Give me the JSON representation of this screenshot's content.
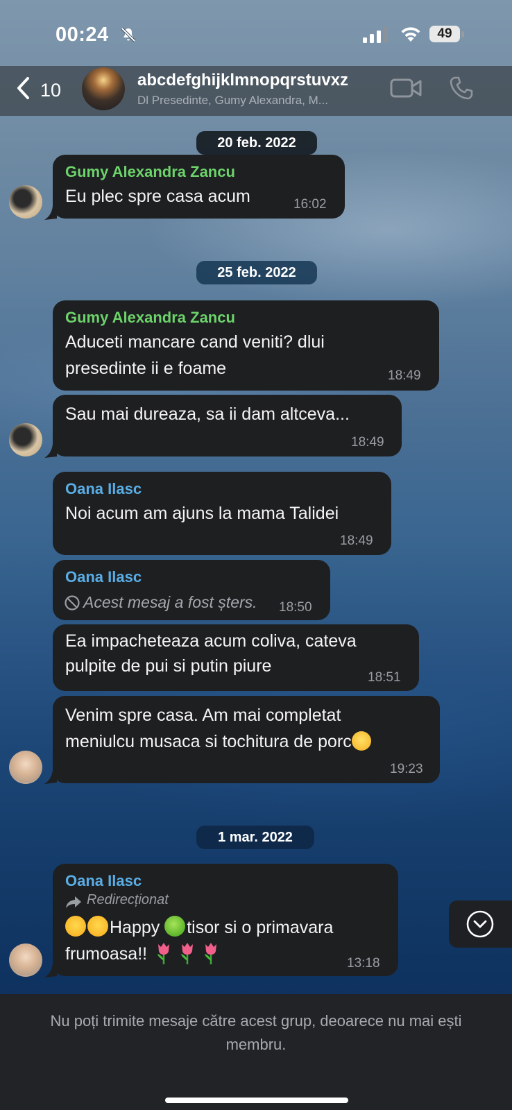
{
  "status_bar": {
    "time": "00:24",
    "battery": "49"
  },
  "header": {
    "back_count": "10",
    "title": "abcdefghijklmnopqrstuvxz",
    "subtitle": "Dl Presedinte, Gumy Alexandra, M..."
  },
  "dates": [
    "20 feb. 2022",
    "25 feb. 2022",
    "1 mar. 2022"
  ],
  "messages": [
    {
      "sender": "Gumy Alexandra Zancu",
      "text": "Eu plec spre casa acum",
      "time": "16:02"
    },
    {
      "sender": "Gumy Alexandra Zancu",
      "lines": [
        "Aduceti mancare cand veniti? dlui",
        "presedinte ii e foame"
      ],
      "time": "18:49"
    },
    {
      "text": "Sau mai dureaza, sa ii dam altceva...",
      "time": "18:49"
    },
    {
      "sender": "Oana Ilasc",
      "text": "Noi acum am ajuns la mama Talidei",
      "time": "18:49"
    },
    {
      "sender": "Oana Ilasc",
      "text": "Acest mesaj a fost șters.",
      "time": "18:50"
    },
    {
      "lines": [
        "Ea impacheteaza acum coliva, cateva",
        "pulpite de pui si putin piure"
      ],
      "time": "18:51"
    },
    {
      "lines": [
        "Venim spre casa. Am mai completat",
        "meniulcu musaca si tochitura de porc"
      ],
      "time": "19:23"
    },
    {
      "sender": "Oana Ilasc",
      "forwarded_label": "Redirecționat",
      "line1_a": "Happy ",
      "line1_b": "tisor si o primavara",
      "line2": "frumoasa!! ",
      "time": "13:18"
    }
  ],
  "footer": {
    "text": "Nu poți trimite mesaje către acest grup, deoarece nu mai ești membru."
  },
  "icons": [
    "bell-slash-icon",
    "signal-icon",
    "wifi-icon",
    "battery-icon",
    "chevron-left-icon",
    "video-call-icon",
    "phone-icon",
    "deleted-icon",
    "forward-icon",
    "scroll-down-icon",
    "hugging-face-emoji",
    "green-apple-emoji",
    "grinning-face-emoji",
    "tulip-emoji"
  ],
  "colors": {
    "sender_green": "#6dd36b",
    "sender_blue": "#5aaee6",
    "bubble": "#1e1f21",
    "timestamp": "#9a9ea3"
  }
}
